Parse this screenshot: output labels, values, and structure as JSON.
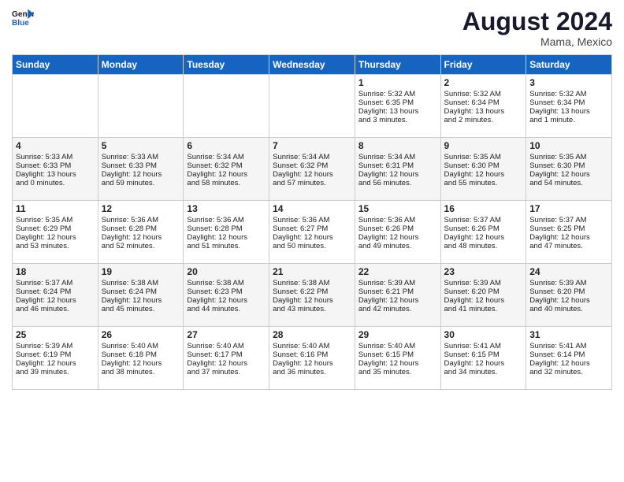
{
  "header": {
    "logo_line1": "General",
    "logo_line2": "Blue",
    "month_year": "August 2024",
    "location": "Mama, Mexico"
  },
  "days_of_week": [
    "Sunday",
    "Monday",
    "Tuesday",
    "Wednesday",
    "Thursday",
    "Friday",
    "Saturday"
  ],
  "weeks": [
    [
      {
        "day": "",
        "content": ""
      },
      {
        "day": "",
        "content": ""
      },
      {
        "day": "",
        "content": ""
      },
      {
        "day": "",
        "content": ""
      },
      {
        "day": "1",
        "content": "Sunrise: 5:32 AM\nSunset: 6:35 PM\nDaylight: 13 hours\nand 3 minutes."
      },
      {
        "day": "2",
        "content": "Sunrise: 5:32 AM\nSunset: 6:34 PM\nDaylight: 13 hours\nand 2 minutes."
      },
      {
        "day": "3",
        "content": "Sunrise: 5:32 AM\nSunset: 6:34 PM\nDaylight: 13 hours\nand 1 minute."
      }
    ],
    [
      {
        "day": "4",
        "content": "Sunrise: 5:33 AM\nSunset: 6:33 PM\nDaylight: 13 hours\nand 0 minutes."
      },
      {
        "day": "5",
        "content": "Sunrise: 5:33 AM\nSunset: 6:33 PM\nDaylight: 12 hours\nand 59 minutes."
      },
      {
        "day": "6",
        "content": "Sunrise: 5:34 AM\nSunset: 6:32 PM\nDaylight: 12 hours\nand 58 minutes."
      },
      {
        "day": "7",
        "content": "Sunrise: 5:34 AM\nSunset: 6:32 PM\nDaylight: 12 hours\nand 57 minutes."
      },
      {
        "day": "8",
        "content": "Sunrise: 5:34 AM\nSunset: 6:31 PM\nDaylight: 12 hours\nand 56 minutes."
      },
      {
        "day": "9",
        "content": "Sunrise: 5:35 AM\nSunset: 6:30 PM\nDaylight: 12 hours\nand 55 minutes."
      },
      {
        "day": "10",
        "content": "Sunrise: 5:35 AM\nSunset: 6:30 PM\nDaylight: 12 hours\nand 54 minutes."
      }
    ],
    [
      {
        "day": "11",
        "content": "Sunrise: 5:35 AM\nSunset: 6:29 PM\nDaylight: 12 hours\nand 53 minutes."
      },
      {
        "day": "12",
        "content": "Sunrise: 5:36 AM\nSunset: 6:28 PM\nDaylight: 12 hours\nand 52 minutes."
      },
      {
        "day": "13",
        "content": "Sunrise: 5:36 AM\nSunset: 6:28 PM\nDaylight: 12 hours\nand 51 minutes."
      },
      {
        "day": "14",
        "content": "Sunrise: 5:36 AM\nSunset: 6:27 PM\nDaylight: 12 hours\nand 50 minutes."
      },
      {
        "day": "15",
        "content": "Sunrise: 5:36 AM\nSunset: 6:26 PM\nDaylight: 12 hours\nand 49 minutes."
      },
      {
        "day": "16",
        "content": "Sunrise: 5:37 AM\nSunset: 6:26 PM\nDaylight: 12 hours\nand 48 minutes."
      },
      {
        "day": "17",
        "content": "Sunrise: 5:37 AM\nSunset: 6:25 PM\nDaylight: 12 hours\nand 47 minutes."
      }
    ],
    [
      {
        "day": "18",
        "content": "Sunrise: 5:37 AM\nSunset: 6:24 PM\nDaylight: 12 hours\nand 46 minutes."
      },
      {
        "day": "19",
        "content": "Sunrise: 5:38 AM\nSunset: 6:24 PM\nDaylight: 12 hours\nand 45 minutes."
      },
      {
        "day": "20",
        "content": "Sunrise: 5:38 AM\nSunset: 6:23 PM\nDaylight: 12 hours\nand 44 minutes."
      },
      {
        "day": "21",
        "content": "Sunrise: 5:38 AM\nSunset: 6:22 PM\nDaylight: 12 hours\nand 43 minutes."
      },
      {
        "day": "22",
        "content": "Sunrise: 5:39 AM\nSunset: 6:21 PM\nDaylight: 12 hours\nand 42 minutes."
      },
      {
        "day": "23",
        "content": "Sunrise: 5:39 AM\nSunset: 6:20 PM\nDaylight: 12 hours\nand 41 minutes."
      },
      {
        "day": "24",
        "content": "Sunrise: 5:39 AM\nSunset: 6:20 PM\nDaylight: 12 hours\nand 40 minutes."
      }
    ],
    [
      {
        "day": "25",
        "content": "Sunrise: 5:39 AM\nSunset: 6:19 PM\nDaylight: 12 hours\nand 39 minutes."
      },
      {
        "day": "26",
        "content": "Sunrise: 5:40 AM\nSunset: 6:18 PM\nDaylight: 12 hours\nand 38 minutes."
      },
      {
        "day": "27",
        "content": "Sunrise: 5:40 AM\nSunset: 6:17 PM\nDaylight: 12 hours\nand 37 minutes."
      },
      {
        "day": "28",
        "content": "Sunrise: 5:40 AM\nSunset: 6:16 PM\nDaylight: 12 hours\nand 36 minutes."
      },
      {
        "day": "29",
        "content": "Sunrise: 5:40 AM\nSunset: 6:15 PM\nDaylight: 12 hours\nand 35 minutes."
      },
      {
        "day": "30",
        "content": "Sunrise: 5:41 AM\nSunset: 6:15 PM\nDaylight: 12 hours\nand 34 minutes."
      },
      {
        "day": "31",
        "content": "Sunrise: 5:41 AM\nSunset: 6:14 PM\nDaylight: 12 hours\nand 32 minutes."
      }
    ]
  ]
}
